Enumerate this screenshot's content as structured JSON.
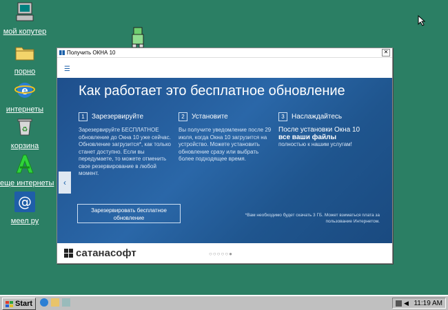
{
  "desktop": {
    "icons": [
      {
        "label": "мой копутер",
        "icon": "computer-icon"
      },
      {
        "label": "порно",
        "icon": "folder-icon"
      },
      {
        "label": "интернеты",
        "icon": "internet-explorer-icon"
      },
      {
        "label": "корзина",
        "icon": "recycle-bin-icon"
      },
      {
        "label": "еще интернеты",
        "icon": "alt-browser-icon"
      },
      {
        "label": "меел ру",
        "icon": "mail-at-icon"
      }
    ]
  },
  "window": {
    "title": "Получить  ОКНА  10",
    "close_label": "✕",
    "menu_icon": "☰",
    "hero_title": "Как работает это бесплатное обновление",
    "steps": [
      {
        "num": "1",
        "head": "Зарезервируйте",
        "text": "Зарезервируйте БЕСПЛАТНОЕ обновление до  Окна  10  уже сейчас. Обновление загрузится*, как только станет доступно. Если вы передумаете, то можете отменить свое резервирование в любой момент."
      },
      {
        "num": "2",
        "head": "Установите",
        "text": "Вы получите уведомление после 29 июля, когда  Окна 10  загрузится на устройство. Можете установить обновление сразу или выбрать более подходящее время."
      },
      {
        "num": "3",
        "head": "Наслаждайтесь",
        "text_pre": "После установки  Окна 10",
        "text_bold": "все ваши файлы",
        "text_post": "полностью к нашим услугам!"
      }
    ],
    "cta_label": "Зарезервировать бесплатное обновление",
    "footnote": "*Вам необходимо будет скачать 3 ГБ. Может взиматься плата за пользование Интернетом.",
    "brand": "сатанасофт",
    "pager": "○○○○○●"
  },
  "taskbar": {
    "start_label": "Start",
    "clock": "11:19 AM"
  }
}
